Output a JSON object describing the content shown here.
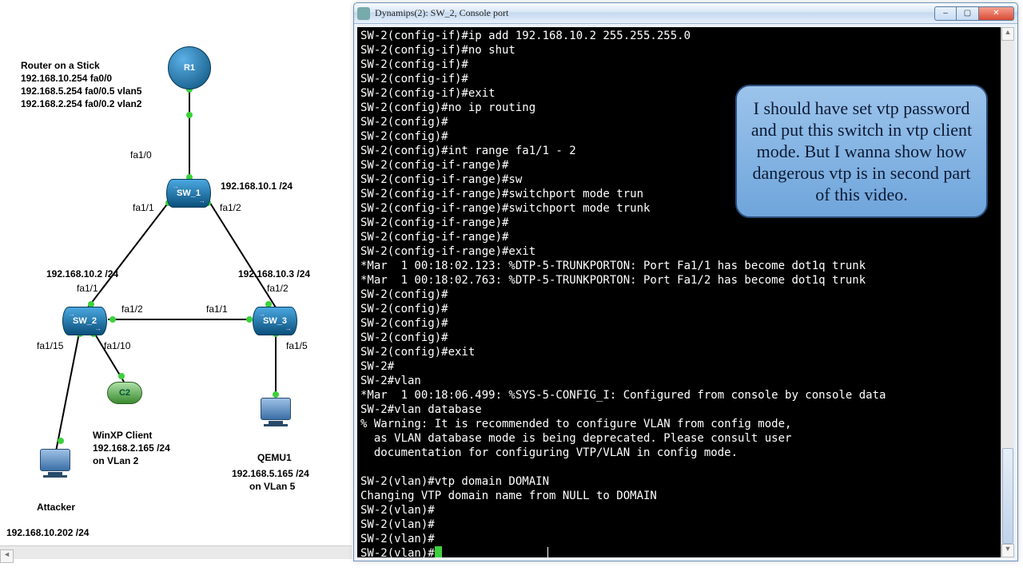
{
  "window": {
    "title": "Dynamips(2): SW_2, Console port",
    "min_icon": "–",
    "max_icon": "▢",
    "close_icon": "✕"
  },
  "callout": {
    "text": "I should have set vtp password and put this switch in vtp client mode. But I wanna show how dangerous vtp is in second part of this video."
  },
  "terminal": {
    "lines": [
      "SW-2(config-if)#ip add 192.168.10.2 255.255.255.0",
      "SW-2(config-if)#no shut",
      "SW-2(config-if)#",
      "SW-2(config-if)#",
      "SW-2(config-if)#exit",
      "SW-2(config)#no ip routing",
      "SW-2(config)#",
      "SW-2(config)#",
      "SW-2(config)#int range fa1/1 - 2",
      "SW-2(config-if-range)#",
      "SW-2(config-if-range)#sw",
      "SW-2(config-if-range)#switchport mode trun",
      "SW-2(config-if-range)#switchport mode trunk",
      "SW-2(config-if-range)#",
      "SW-2(config-if-range)#",
      "SW-2(config-if-range)#exit",
      "*Mar  1 00:18:02.123: %DTP-5-TRUNKPORTON: Port Fa1/1 has become dot1q trunk",
      "*Mar  1 00:18:02.763: %DTP-5-TRUNKPORTON: Port Fa1/2 has become dot1q trunk",
      "SW-2(config)#",
      "SW-2(config)#",
      "SW-2(config)#",
      "SW-2(config)#",
      "SW-2(config)#exit",
      "SW-2#",
      "SW-2#vlan",
      "*Mar  1 00:18:06.499: %SYS-5-CONFIG_I: Configured from console by console data",
      "SW-2#vlan database",
      "% Warning: It is recommended to configure VLAN from config mode,",
      "  as VLAN database mode is being deprecated. Please consult user",
      "  documentation for configuring VTP/VLAN in config mode.",
      "",
      "SW-2(vlan)#vtp domain DOMAIN",
      "Changing VTP domain name from NULL to DOMAIN",
      "SW-2(vlan)#",
      "SW-2(vlan)#",
      "SW-2(vlan)#",
      "SW-2(vlan)#"
    ]
  },
  "topology": {
    "router_title": "Router on a Stick",
    "router_lines": [
      "192.168.10.254  fa0/0",
      "192.168.5.254  fa0/0.5   vlan5",
      "192.168.2.254  fa0/0.2   vlan2"
    ],
    "nodes": {
      "R1": "R1",
      "SW_1": "SW_1",
      "SW_2": "SW_2",
      "SW_3": "SW_3",
      "C2": "C2",
      "QEMU1": "QEMU1",
      "Attacker": "Attacker",
      "WinXP_label": "WinXP Client",
      "WinXP_ip": "192.168.2.165 /24",
      "WinXP_vlan": "on VLan 2",
      "QEMU_ip": "192.168.5.165 /24",
      "QEMU_vlan": "on VLan 5",
      "Attacker_ip": "192.168.10.202 /24"
    },
    "ips": {
      "sw1": "192.168.10.1 /24",
      "sw2": "192.168.10.2 /24",
      "sw3": "192.168.10.3 /24"
    },
    "ports": {
      "r1_down": "fa1/0",
      "sw1_l": "fa1/1",
      "sw1_r": "fa1/2",
      "sw2_top": "fa1/1",
      "sw2_r": "fa1/2",
      "sw3_top": "fa1/2",
      "sw3_l": "fa1/1",
      "sw2_p10": "fa1/10",
      "sw2_p15": "fa1/15",
      "sw3_p5": "fa1/5"
    }
  }
}
